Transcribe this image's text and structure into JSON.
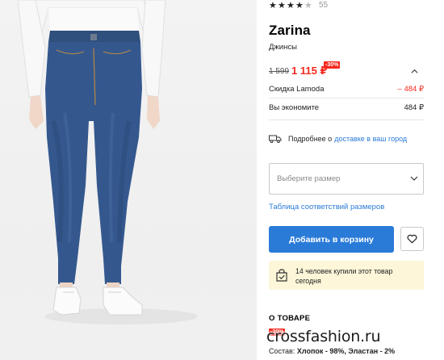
{
  "rating": {
    "value": 4.5,
    "max": 5,
    "reviews_count": "55"
  },
  "product": {
    "brand": "Zarina",
    "category": "Джинсы"
  },
  "price": {
    "old": "1 599",
    "new": "1 115 ₽",
    "discount_badge": "-30%",
    "lamoda_discount_label": "Скидка Lamoda",
    "lamoda_discount_value": "– 484 ₽",
    "savings_label": "Вы экономите",
    "savings_value": "484 ₽"
  },
  "delivery": {
    "text": "Подробнее о",
    "link": "доставке в ваш город"
  },
  "size": {
    "placeholder": "Выберите размер",
    "table_link": "Таблица соответствий размеров"
  },
  "actions": {
    "add_to_cart": "Добавить в корзину"
  },
  "social_proof": {
    "text": "14 человек купили этот товар сегодня"
  },
  "about": {
    "heading": "О ТОВАРЕ",
    "badge": "-30%",
    "composition_label": "Состав:",
    "composition_value": "Хлопок - 98%, Эластан - 2%"
  },
  "watermark": "crossfashion.ru",
  "colors": {
    "accent_blue": "#2a7bd8",
    "sale_red": "#f5281e",
    "notice_bg": "#fdf6d9"
  },
  "icons": [
    "star-icon",
    "chevron-up-icon",
    "truck-icon",
    "chevron-down-icon",
    "heart-icon",
    "bag-check-icon"
  ]
}
